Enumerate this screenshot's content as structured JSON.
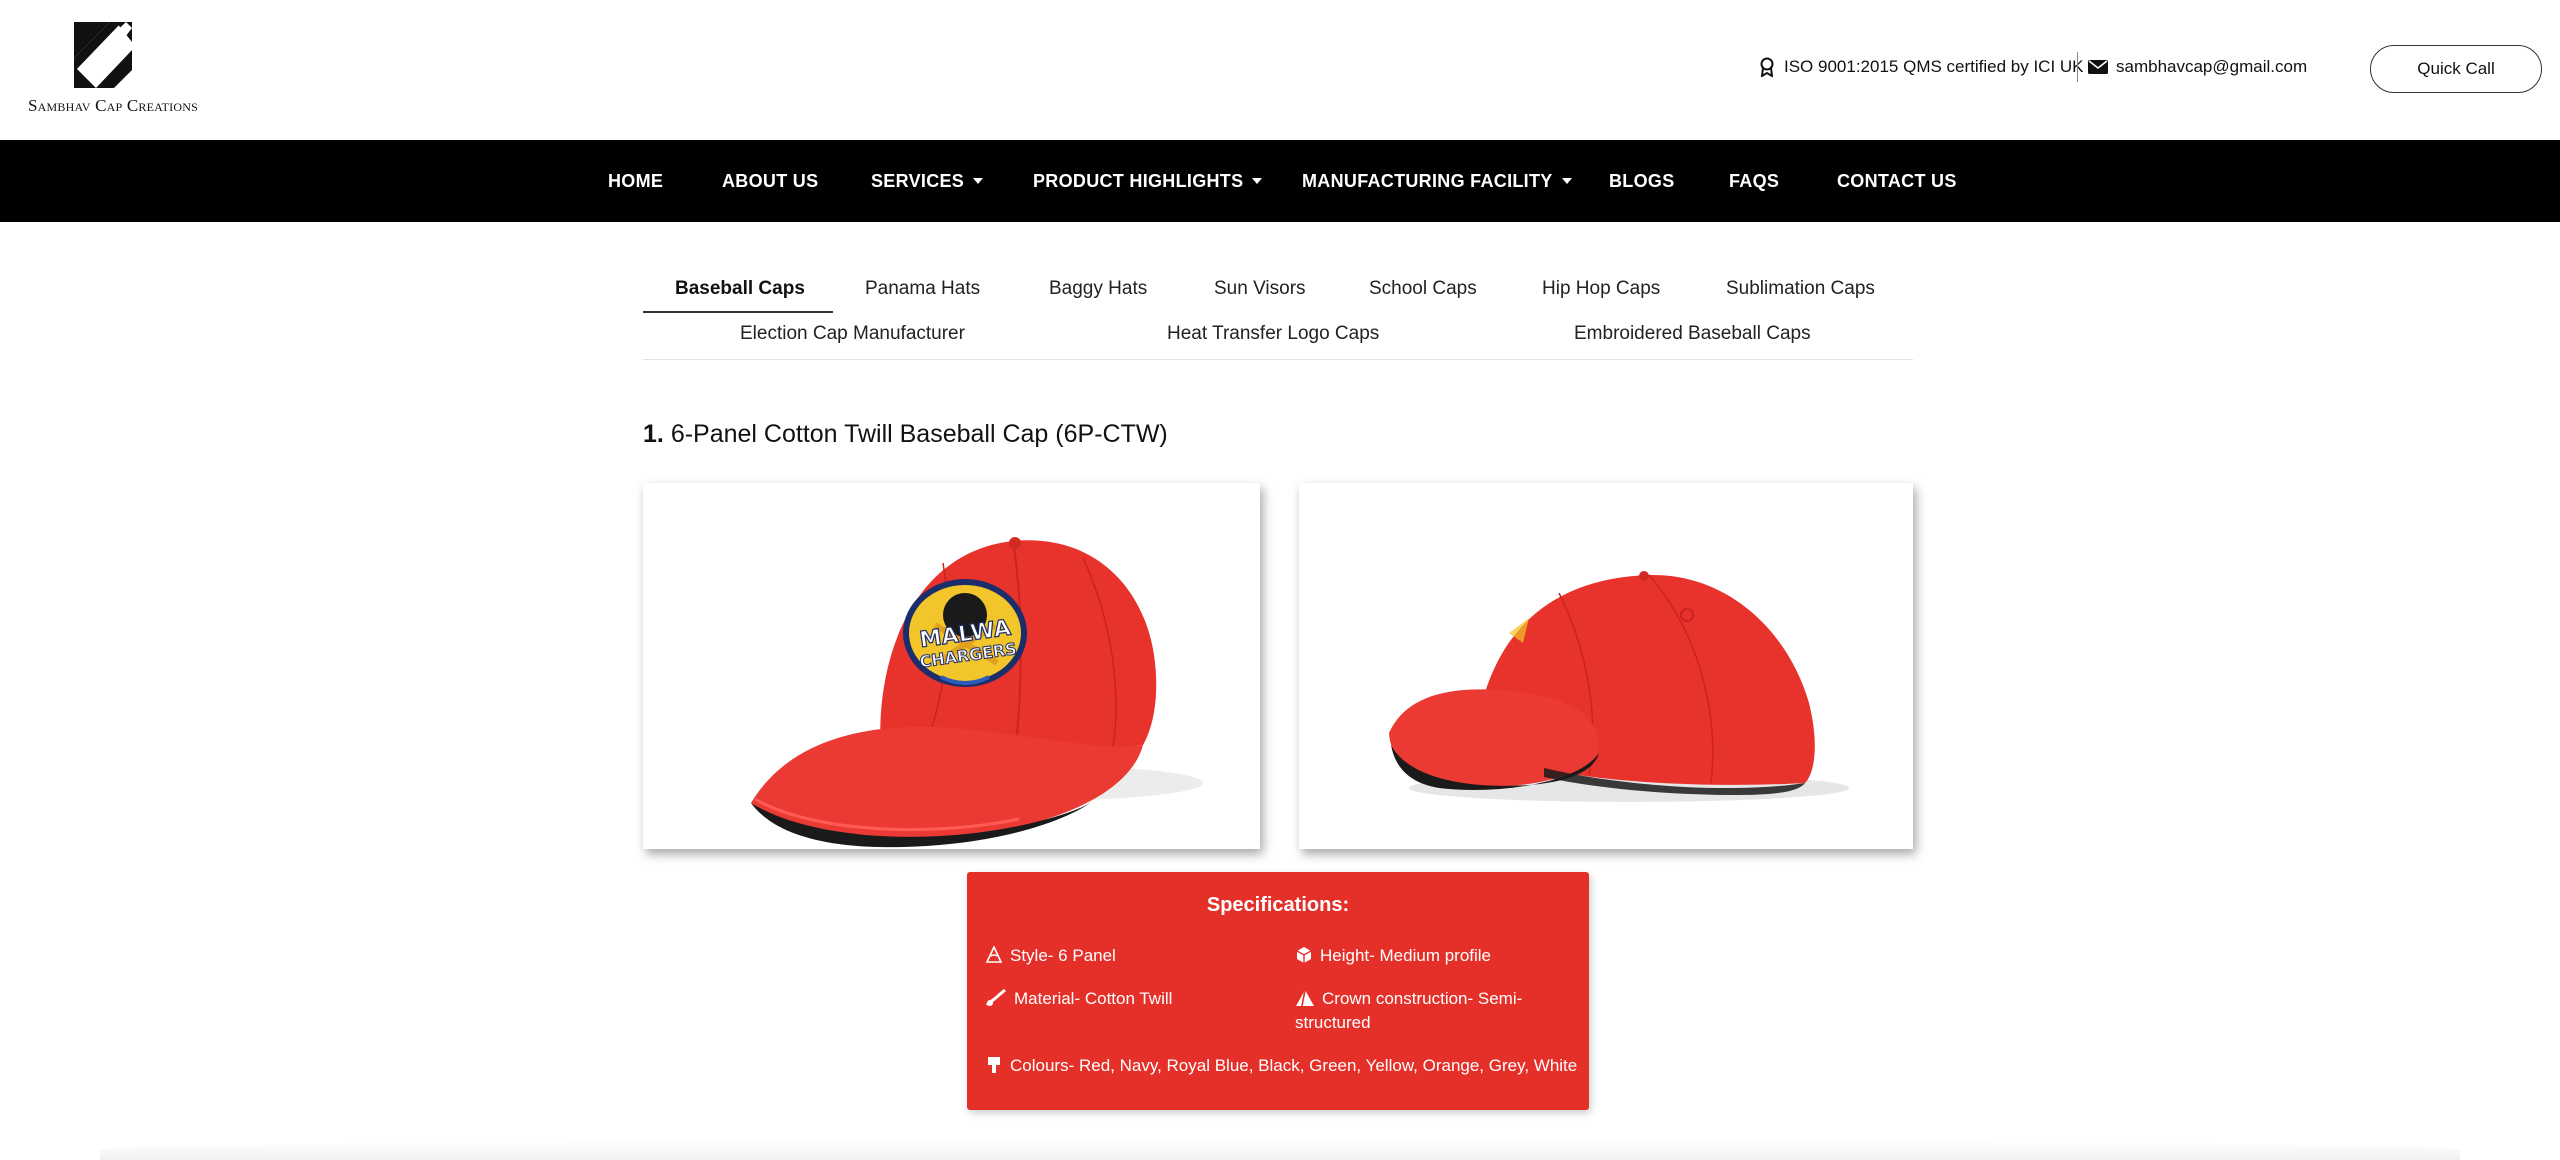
{
  "brand": {
    "logo_text": "Sambhav Cap Creations"
  },
  "header": {
    "certification": "ISO 9001:2015 QMS certified by ICI UK",
    "email": "sambhavcap@gmail.com",
    "quick_call_label": "Quick Call"
  },
  "nav": {
    "items": [
      {
        "label": "HOME"
      },
      {
        "label": "ABOUT US"
      },
      {
        "label": "SERVICES"
      },
      {
        "label": "PRODUCT HIGHLIGHTS"
      },
      {
        "label": "MANUFACTURING FACILITY"
      },
      {
        "label": "BLOGS"
      },
      {
        "label": "FAQS"
      },
      {
        "label": "CONTACT US"
      }
    ]
  },
  "tabs": {
    "row1": [
      "Baseball Caps",
      "Panama Hats",
      "Baggy Hats",
      "Sun Visors",
      "School Caps",
      "Hip Hop Caps",
      "Sublimation Caps"
    ],
    "row2": [
      "Election Cap Manufacturer",
      "Heat Transfer Logo Caps",
      "Embroidered Baseball Caps"
    ],
    "active": "Baseball Caps"
  },
  "product": {
    "number": "1.",
    "title": "6-Panel Cotton Twill Baseball Cap (6P-CTW)",
    "logo_text_line1": "MALWA",
    "logo_text_line2": "CHARGERS"
  },
  "specifications": {
    "title": "Specifications:",
    "style": "Style- 6 Panel",
    "height": "Height- Medium profile",
    "material": "Material- Cotton Twill",
    "crown": "Crown construction- Semi-structured",
    "crown_line1": "Crown construction- Semi-",
    "crown_line2": "structured",
    "colours": "Colours- Red, Navy, Royal Blue, Black, Green, Yellow, Orange, Grey, White"
  },
  "colors": {
    "nav_bg": "#000000",
    "spec_bg": "#e5302a",
    "cap_red": "#e8322c"
  }
}
